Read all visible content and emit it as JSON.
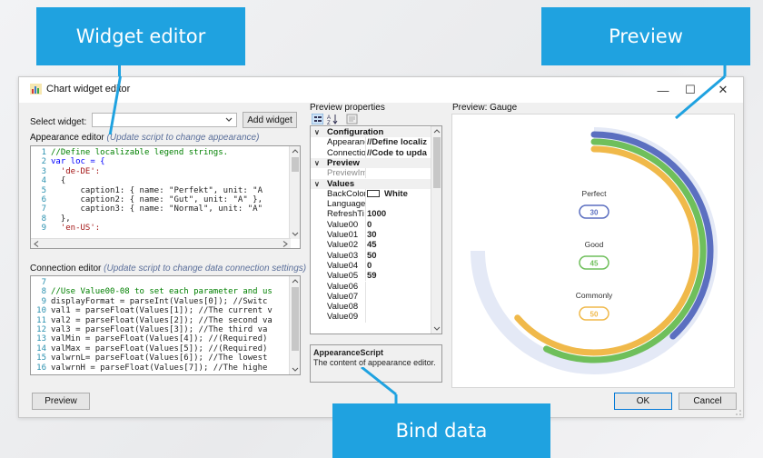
{
  "callouts": {
    "widget_editor": "Widget editor",
    "preview": "Preview",
    "bind_data": "Bind data"
  },
  "window": {
    "title": "Chart widget editor",
    "controls": {
      "minimize": "—",
      "maximize": "☐",
      "close": "✕"
    }
  },
  "select_widget": {
    "label": "Select widget:",
    "value": "",
    "add_button": "Add widget"
  },
  "appearance_editor": {
    "label": "Appearance editor",
    "hint": "(Update script to change appearance)",
    "lines": [
      {
        "n": "1",
        "text": "//Define localizable legend strings.",
        "color": "#008000"
      },
      {
        "n": "2",
        "text": "var loc = {",
        "color": "#0000ff"
      },
      {
        "n": "3",
        "text": "  'de-DE':",
        "color": "#a31515"
      },
      {
        "n": "4",
        "text": "  {",
        "color": "#222222"
      },
      {
        "n": "5",
        "text": "      caption1: { name: \"Perfekt\", unit: \"A",
        "color": "#222222"
      },
      {
        "n": "6",
        "text": "      caption2: { name: \"Gut\", unit: \"A\" },",
        "color": "#222222"
      },
      {
        "n": "7",
        "text": "      caption3: { name: \"Normal\", unit: \"A\"",
        "color": "#222222"
      },
      {
        "n": "8",
        "text": "  },",
        "color": "#222222"
      },
      {
        "n": "9",
        "text": "  'en-US':",
        "color": "#a31515"
      }
    ]
  },
  "connection_editor": {
    "label": "Connection editor",
    "hint": "(Update script to change data connection settings)",
    "lines": [
      {
        "n": "7",
        "text": "",
        "color": "#222222"
      },
      {
        "n": "8",
        "text": "//Use Value00-08 to set each parameter and us",
        "color": "#008000"
      },
      {
        "n": "9",
        "text": "displayFormat = parseInt(Values[0]); //Switc",
        "color": "#222222"
      },
      {
        "n": "10",
        "text": "val1 = parseFloat(Values[1]); //The current v",
        "color": "#222222"
      },
      {
        "n": "11",
        "text": "val2 = parseFloat(Values[2]); //The second va",
        "color": "#222222"
      },
      {
        "n": "12",
        "text": "val3 = parseFloat(Values[3]); //The third va",
        "color": "#222222"
      },
      {
        "n": "13",
        "text": "valMin = parseFloat(Values[4]); //(Required)",
        "color": "#222222"
      },
      {
        "n": "14",
        "text": "valMax = parseFloat(Values[5]); //(Required)",
        "color": "#222222"
      },
      {
        "n": "15",
        "text": "valwrnL= parseFloat(Values[6]); //The lowest",
        "color": "#222222"
      },
      {
        "n": "16",
        "text": "valwrnH = parseFloat(Values[7]); //The highe",
        "color": "#222222"
      }
    ]
  },
  "preview_properties": {
    "label": "Preview properties",
    "rows": [
      {
        "type": "cat",
        "chev": "∨",
        "name": "Configuration"
      },
      {
        "type": "prop",
        "name": "Appearanc",
        "value": "//Define localiz"
      },
      {
        "type": "prop",
        "name": "Connectio",
        "value": "//Code to upda"
      },
      {
        "type": "cat",
        "chev": "∨",
        "name": "Preview"
      },
      {
        "type": "prop",
        "name": "PreviewIm",
        "value": "",
        "muted": true
      },
      {
        "type": "cat",
        "chev": "∨",
        "name": "Values"
      },
      {
        "type": "prop",
        "name": "BackColor",
        "value": "White",
        "swatch": true
      },
      {
        "type": "prop",
        "name": "Language",
        "value": ""
      },
      {
        "type": "prop",
        "name": "RefreshTi",
        "value": "1000"
      },
      {
        "type": "prop",
        "name": "Value00",
        "value": "0"
      },
      {
        "type": "prop",
        "name": "Value01",
        "value": "30"
      },
      {
        "type": "prop",
        "name": "Value02",
        "value": "45"
      },
      {
        "type": "prop",
        "name": "Value03",
        "value": "50"
      },
      {
        "type": "prop",
        "name": "Value04",
        "value": "0"
      },
      {
        "type": "prop",
        "name": "Value05",
        "value": "59"
      },
      {
        "type": "prop",
        "name": "Value06",
        "value": ""
      },
      {
        "type": "prop",
        "name": "Value07",
        "value": ""
      },
      {
        "type": "prop",
        "name": "Value08",
        "value": ""
      },
      {
        "type": "prop",
        "name": "Value09",
        "value": ""
      }
    ],
    "description": {
      "title": "AppearanceScript",
      "text": "The content of appearance editor."
    }
  },
  "preview": {
    "label": "Preview: Gauge",
    "gauge": {
      "min": 0,
      "max": 59,
      "track_color": "#e4e9f6",
      "rings": [
        {
          "name": "Perfect",
          "value": 30,
          "color": "#5b6fc0"
        },
        {
          "name": "Good",
          "value": 45,
          "color": "#6fbf5b"
        },
        {
          "name": "Commonly",
          "value": 50,
          "color": "#f0b94a"
        }
      ]
    }
  },
  "buttons": {
    "preview": "Preview",
    "ok": "OK",
    "cancel": "Cancel"
  },
  "colors": {
    "callout": "#1fa2e0",
    "focus": "#0078d7"
  }
}
